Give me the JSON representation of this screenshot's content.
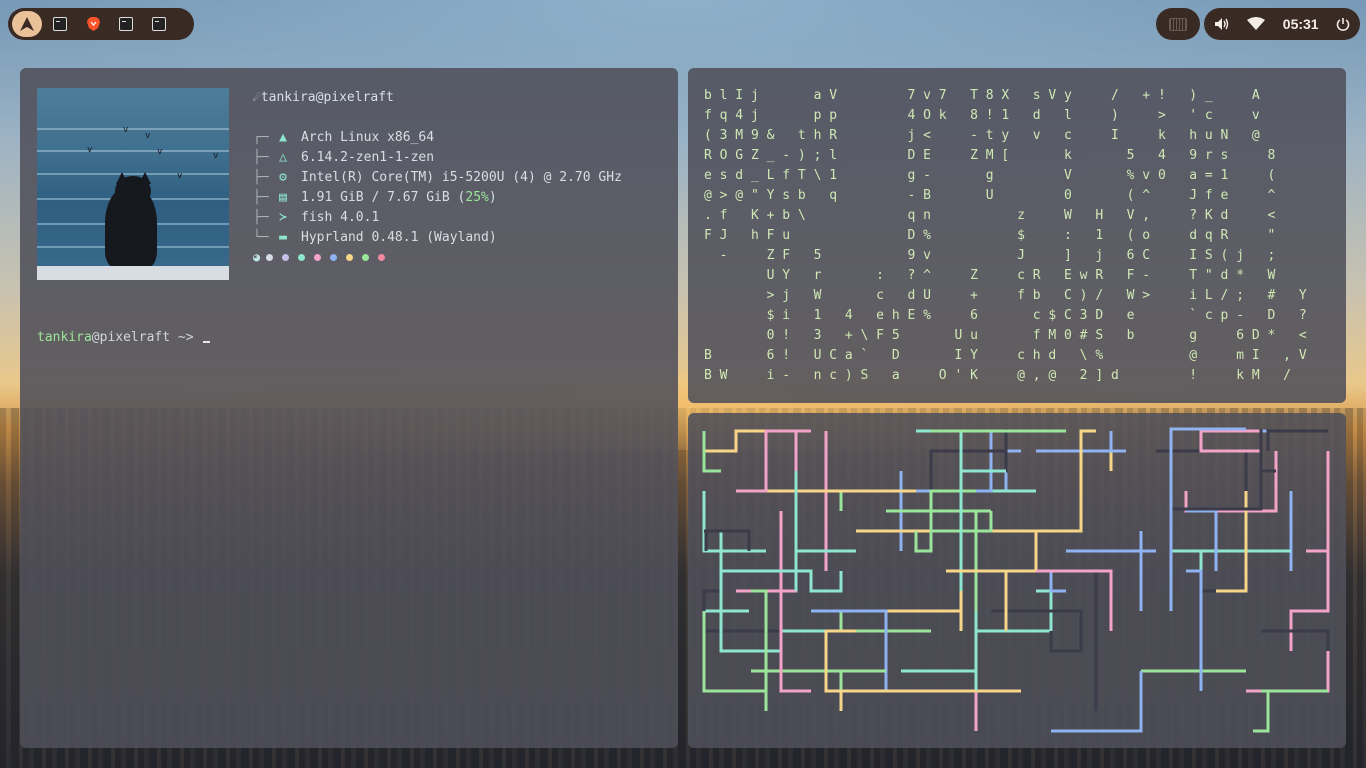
{
  "topbar": {
    "workspaces": [
      {
        "icon": "arch-logo-icon",
        "active": true
      },
      {
        "icon": "terminal-icon",
        "active": false
      },
      {
        "icon": "brave-browser-icon",
        "active": false
      },
      {
        "icon": "terminal-icon",
        "active": false
      },
      {
        "icon": "terminal-icon",
        "active": false
      }
    ],
    "keyboard_icon": "keyboard-icon",
    "volume_icon": "volume-icon",
    "wifi_icon": "wifi-icon",
    "clock": "05:31",
    "power_icon": "power-icon"
  },
  "fastfetch": {
    "user_host": "tankira@pixelraft",
    "rows": [
      {
        "icon": "arch-icon",
        "text": "Arch Linux x86_64"
      },
      {
        "icon": "kernel-icon",
        "text": "6.14.2-zen1-1-zen"
      },
      {
        "icon": "cpu-icon",
        "text": "Intel(R) Core(TM) i5-5200U (4) @ 2.70 GHz"
      },
      {
        "icon": "memory-icon",
        "text": "1.91 GiB / 7.67 GiB (",
        "pct": "25%",
        "tail": ")"
      },
      {
        "icon": "shell-icon",
        "text": "fish 4.0.1"
      },
      {
        "icon": "wm-icon",
        "text": "Hyprland 0.48.1 (Wayland)"
      }
    ],
    "palette": [
      "#bfe3e0",
      "#d8dce6",
      "#c5c0e6",
      "#8ee6d0",
      "#f4a3c8",
      "#8fb2f0",
      "#f7d68a",
      "#9be59a",
      "#f08aa0"
    ]
  },
  "prompt": {
    "user": "tankira",
    "at": "@pixelraft ~> "
  },
  "matrix": {
    "lines": [
      "b l I j       a V         7 v 7   T 8 X   s V y     /   + !   ) _     A",
      "f q 4 j       p p         4 O k   8 ! 1   d   l     )     >   ' c     v",
      "( 3 M 9 &   t h R         j <     - t y   v   c     I     k   h u N   @",
      "R O G Z _ - ) ; l         D E     Z M [       k       5   4   9 r s     8",
      "e s d _ L f T \\ 1         g -       g         V       % v 0   a = 1     (",
      "@ > @ \" Y s b   q         - B       U         0       ( ^     J f e     ^",
      ". f   K + b \\             q n           z     W   H   V ,     ? K d     <",
      "F J   h F u               D %           $     :   1   ( o     d q R     \"",
      "  -     Z F   5           9 v           J     ]   j   6 C     I S ( j   ;",
      "        U Y   r       :   ? ^     Z     c R   E w R   F -     T \" d *   W",
      "        > j   W       c   d U     +     f b   C ) /   W >     i L / ;   #   Y",
      "        $ i   1   4   e h E %     6       c $ C 3 D   e       ` c p -   D   ?",
      "        0 !   3   + \\ F 5       U u       f M 0 # S   b       g     6 D *   <",
      "B       6 !   U C a `   D       I Y     c h d   \\ %           @     m I   , V",
      "B W     i -   n c ) S   a     O ' K     @ , @   2 ] d         !     k M   /"
    ]
  }
}
